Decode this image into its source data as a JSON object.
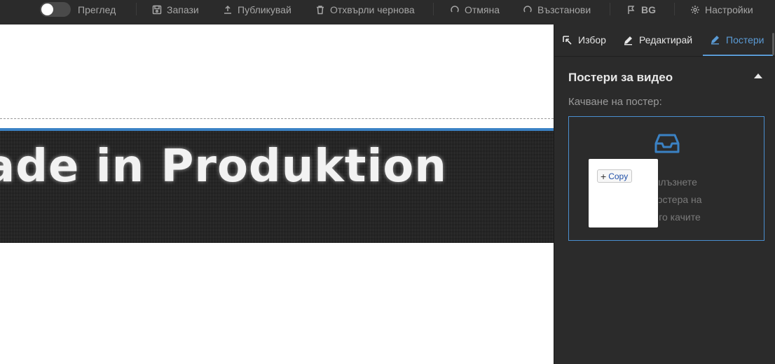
{
  "toolbar": {
    "preview_label": "Преглед",
    "save_label": "Запази",
    "publish_label": "Публикувай",
    "discard_label": "Отхвърли чернова",
    "undo_label": "Отмяна",
    "redo_label": "Възстанови",
    "language_label": "BG",
    "settings_label": "Настройки"
  },
  "canvas": {
    "hero_text": "ade in Produktion"
  },
  "panel": {
    "tabs": [
      {
        "label": "Избор",
        "icon": "select-cursor-icon"
      },
      {
        "label": "Редактирай",
        "icon": "pencil-icon"
      },
      {
        "label": "Постери",
        "icon": "pencil-icon",
        "active": true
      }
    ],
    "section_title": "Постери за видео",
    "upload_label": "Качване на постер:",
    "dropzone": {
      "lines": [
        "или плъзнете",
        "е за постера на",
        "за да го качите"
      ]
    }
  },
  "drag": {
    "copy_label": "Copy"
  },
  "colors": {
    "accent": "#5b9bd5",
    "panel_bg": "#2b2b2b"
  }
}
